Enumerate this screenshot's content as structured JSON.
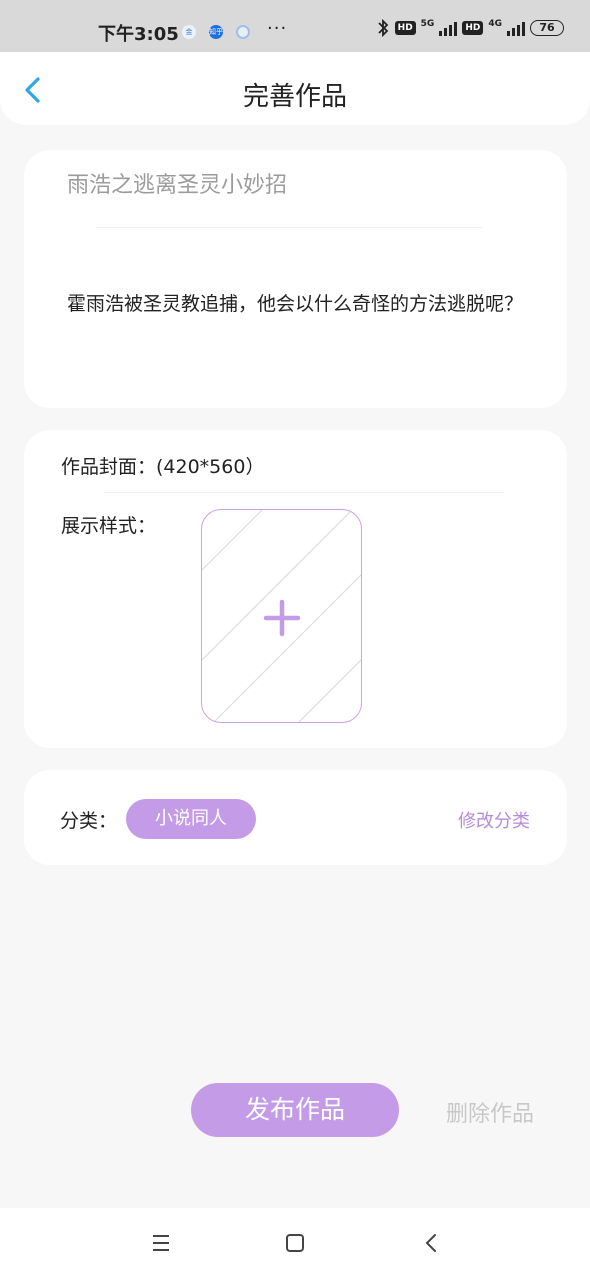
{
  "status_bar": {
    "time": "下午3:05",
    "app_icon_1": "金",
    "app_icon_2": "知乎",
    "more_dots": "···",
    "net_1": "5G",
    "net_2": "4G",
    "hd_1": "HD",
    "hd_2": "HD",
    "battery": "76"
  },
  "header": {
    "title": "完善作品",
    "back_icon": "chevron-left-icon"
  },
  "work": {
    "title": "雨浩之逃离圣灵小妙招",
    "description": "霍雨浩被圣灵教追捕，他会以什么奇怪的方法逃脱呢？"
  },
  "cover": {
    "label": "作品封面：(420*560）",
    "style_label": "展示样式：",
    "upload_icon": "plus-icon"
  },
  "category": {
    "label": "分类：",
    "value": "小说同人",
    "edit_label": "修改分类"
  },
  "actions": {
    "publish_label": "发布作品",
    "delete_label": "删除作品"
  },
  "colors": {
    "accent": "#c49be6",
    "accent_text": "#b68bd8",
    "back_arrow": "#2aa8e8",
    "background": "#f7f7f7"
  }
}
